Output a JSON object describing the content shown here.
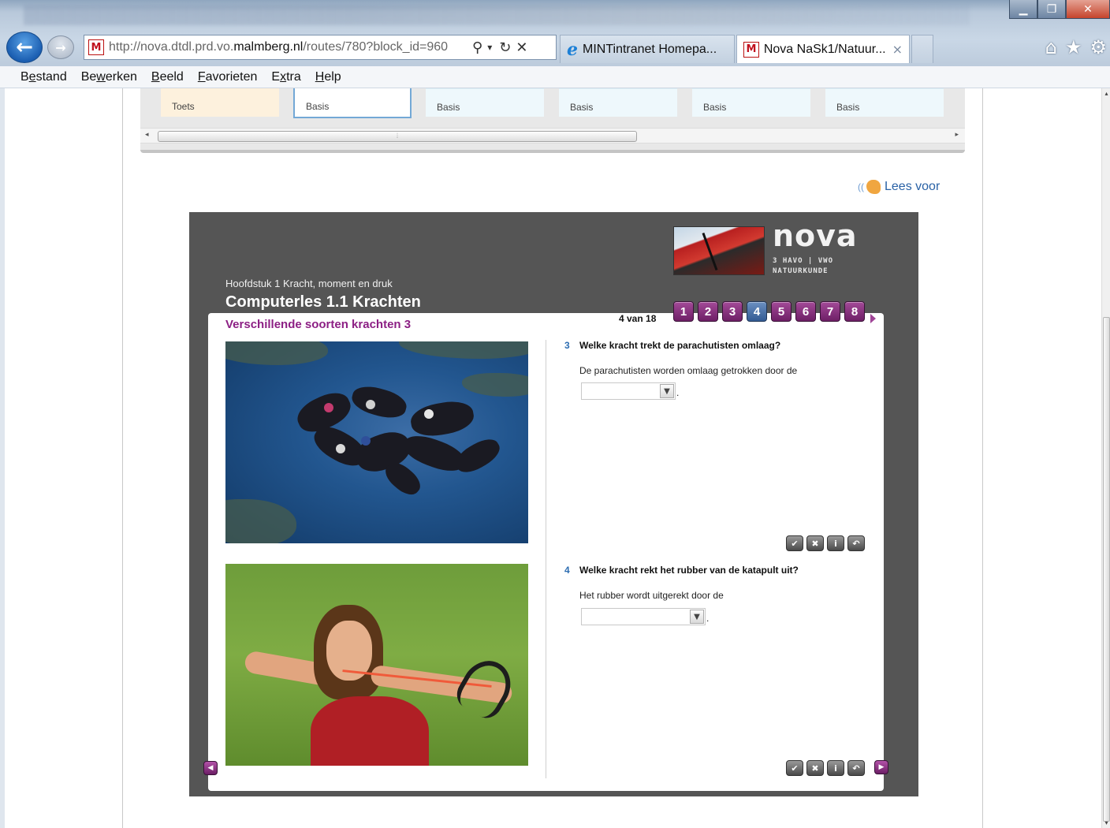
{
  "browser": {
    "url_prefix": "http://nova.dtdl.prd.vo.",
    "url_domain": "malmberg.nl",
    "url_path": "/routes/780?block_id=960",
    "tabs": [
      {
        "label": "MINTintranet Homepa..."
      },
      {
        "label": "Nova NaSk1/Natuur...",
        "close": "×"
      }
    ],
    "menu": [
      "Bestand",
      "Bewerken",
      "Beeld",
      "Favorieten",
      "Extra",
      "Help"
    ],
    "menu_accel": [
      "e",
      "w",
      "B",
      "F",
      "x",
      "H"
    ],
    "icons": [
      "back-arrow-icon",
      "forward-arrow-icon",
      "search-icon",
      "refresh-icon",
      "stop-icon",
      "home-icon",
      "favorites-star-icon",
      "settings-gear-icon"
    ]
  },
  "blocks": [
    {
      "label": "Toets",
      "kind": "toets"
    },
    {
      "label": "Basis",
      "kind": "basis",
      "active": true
    },
    {
      "label": "Basis",
      "kind": "basis"
    },
    {
      "label": "Basis",
      "kind": "basis"
    },
    {
      "label": "Basis",
      "kind": "basis"
    },
    {
      "label": "Basis",
      "kind": "basis"
    }
  ],
  "read_aloud": "Lees voor",
  "lesson": {
    "brand": "nova",
    "brand_sub1": "3 HAVO | VWO",
    "brand_sub2": "NATUURKUNDE",
    "chapter": "Hoofdstuk 1 Kracht, moment en druk",
    "title": "Computerles 1.1 Krachten",
    "page_count": "4 van 18",
    "pages": [
      "1",
      "2",
      "3",
      "4",
      "5",
      "6",
      "7",
      "8"
    ],
    "current_page": "4",
    "section_title": "Verschillende soorten krachten 3",
    "questions": [
      {
        "number": "3",
        "text": "Welke kracht trekt de parachutisten omlaag?",
        "sub": "De parachutisten worden omlaag getrokken door de",
        "selected": ""
      },
      {
        "number": "4",
        "text": "Welke kracht rekt het rubber van de katapult uit?",
        "sub": "Het rubber wordt uitgerekt door de",
        "selected": ""
      }
    ]
  },
  "colors": {
    "accent_purple": "#8c1f84",
    "lesson_frame": "#555555",
    "link_blue": "#2a62a6"
  }
}
